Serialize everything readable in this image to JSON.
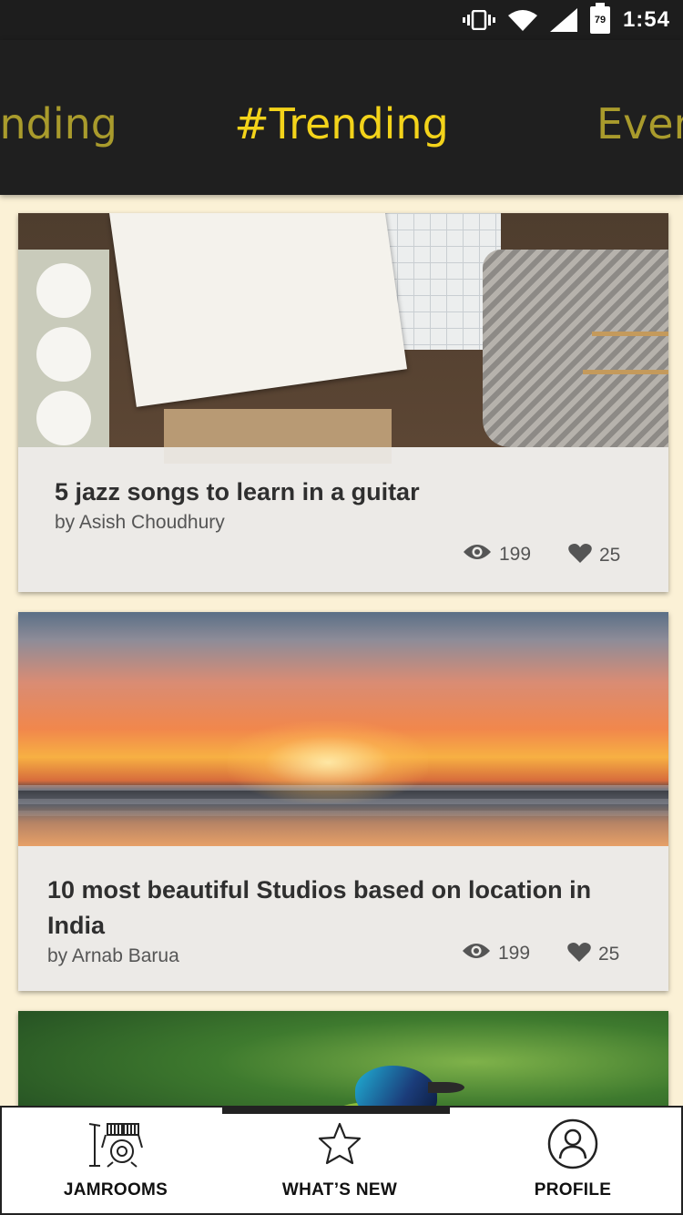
{
  "status_bar": {
    "time": "1:54",
    "battery": "79",
    "icons": [
      "vibrate-icon",
      "wifi-icon",
      "cell-signal-icon",
      "battery-icon"
    ]
  },
  "categories": {
    "previous": "#Trending",
    "current": "#Trending",
    "next": "Events"
  },
  "colors": {
    "accent": "#f3d31a",
    "accent_dim": "#a99b2c",
    "header_bg": "#1f1f1f",
    "page_bg": "#fbf1d6"
  },
  "posts": [
    {
      "title": "5 jazz songs to learn in a guitar",
      "author": "by Asish Choudhury",
      "views": "199",
      "likes": "25"
    },
    {
      "title": "10 most beautiful Studios based on location in India",
      "author": "by Arnab Barua",
      "views": "199",
      "likes": "25"
    }
  ],
  "bottom_nav": {
    "items": [
      {
        "label": "JAMROOMS",
        "icon": "drum-kit-icon"
      },
      {
        "label": "WHAT’S NEW",
        "icon": "star-icon"
      },
      {
        "label": "PROFILE",
        "icon": "user-icon"
      }
    ],
    "active_index": 1
  }
}
